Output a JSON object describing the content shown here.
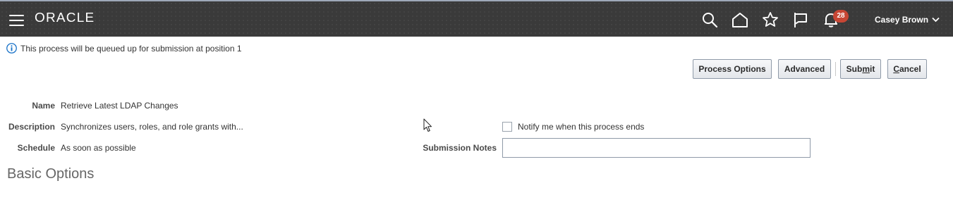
{
  "header": {
    "logo": "ORACLE",
    "notification_count": "28",
    "user_name": "Casey Brown",
    "icons": [
      "menu-icon",
      "search-icon",
      "home-icon",
      "star-icon",
      "flag-icon",
      "bell-icon",
      "chevron-down-icon"
    ]
  },
  "info_message": "This process will be queued up for submission at position 1",
  "buttons": {
    "process_options": "Process Options",
    "advanced": "Advanced",
    "submit_pre": "Sub",
    "submit_mn": "m",
    "submit_post": "it",
    "cancel_mn": "C",
    "cancel_post": "ancel"
  },
  "details": {
    "name_label": "Name",
    "name_value": "Retrieve Latest LDAP Changes",
    "description_label": "Description",
    "description_value": "Synchronizes users, roles, and role grants with...",
    "schedule_label": "Schedule",
    "schedule_value": "As soon as possible"
  },
  "notify": {
    "label": "Notify me when this process ends",
    "checked": false
  },
  "submission_notes": {
    "label": "Submission Notes",
    "value": ""
  },
  "section_title": "Basic Options",
  "colors": {
    "header_bg": "#3a3a3a",
    "badge": "#c74634",
    "info_icon": "#1a73c8"
  }
}
